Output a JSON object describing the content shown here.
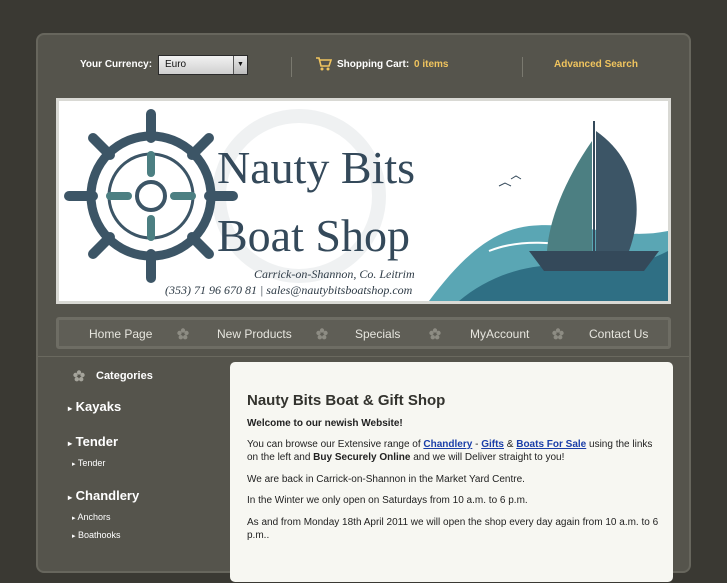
{
  "header": {
    "currency_label": "Your Currency:",
    "currency_value": "Euro",
    "cart_label": "Shopping Cart:",
    "cart_count": "0 items",
    "advanced_search": "Advanced Search"
  },
  "banner": {
    "brand_line1": "Nauty Bits",
    "brand_line2": "Boat Shop",
    "address": "Carrick-on-Shannon, Co. Leitrim",
    "contact": "(353) 71 96 670 81 | sales@nautybitsboatshop.com"
  },
  "nav": {
    "items": [
      "Home Page",
      "New Products",
      "Specials",
      "MyAccount",
      "Contact Us"
    ]
  },
  "sidebar": {
    "heading": "Categories",
    "categories": [
      {
        "label": "Kayaks"
      },
      {
        "label": "Tender",
        "sub": [
          "Tender"
        ]
      },
      {
        "label": "Chandlery",
        "sub": [
          "Anchors",
          "Boathooks"
        ]
      }
    ]
  },
  "content": {
    "title": "Nauty Bits Boat & Gift Shop",
    "welcome": "Welcome to our newish Website!",
    "p1_before": "You can browse our Extensive range of ",
    "link_chandlery": "Chandlery",
    "sep1": " - ",
    "link_gifts": "Gifts",
    "sep2": " & ",
    "link_boats": "Boats For Sale",
    "p1_after": " using the links on the left and ",
    "p1_bold": "Buy Securely Online",
    "p1_end": " and we will Deliver straight to you!",
    "p2": "We are back in Carrick-on-Shannon in the Market Yard Centre.",
    "p3": "In the Winter we only open on Saturdays from 10 a.m. to 6 p.m.",
    "p4": "As and from Monday 18th April 2011 we will open the shop every day again from 10 a.m. to 6 p.m.."
  },
  "colors": {
    "accent": "#f0c45e",
    "background": "#3a3933",
    "panel": "#55544c",
    "brand_text": "#34495a",
    "link": "#1a3ea8"
  }
}
